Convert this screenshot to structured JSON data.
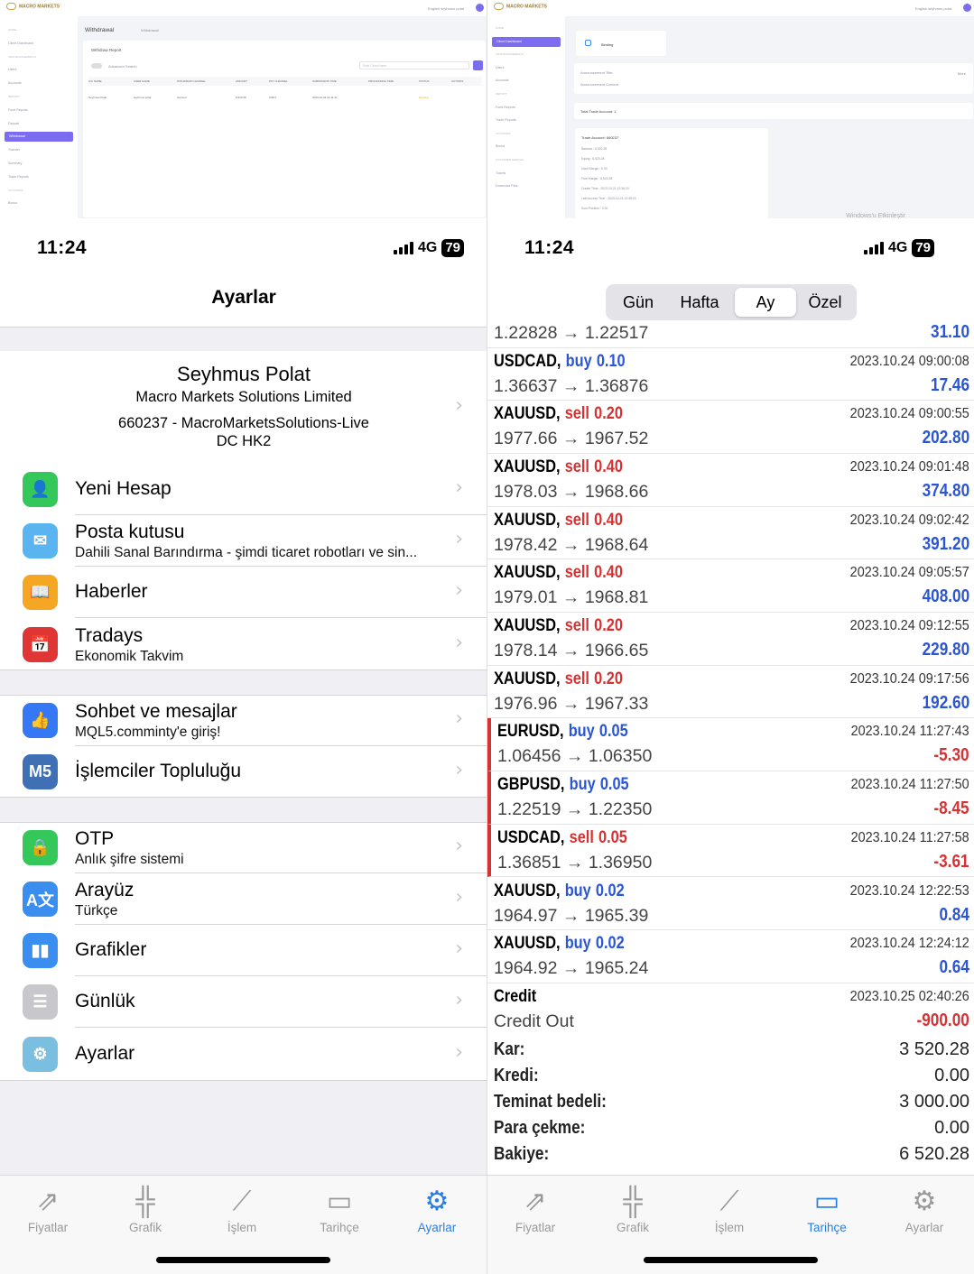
{
  "left": {
    "web": {
      "brand": "MACRO MARKETS",
      "page_title": "Withdrawal",
      "breadcrumb": "Withdrawal",
      "report_title": "Withdraw Report",
      "advanced_search": "Advanced Search",
      "search_placeholder": "Enter Client Name",
      "user_label": "English   seyhmus polat",
      "columns": [
        "A/C NAME",
        "USER NAME",
        "WITHDRAW CHANNEL",
        "AMOUNT",
        "PAY CHANNEL",
        "SUBMISSION TIME",
        "PROCESSING TIME",
        "STATUS",
        "ACTIONS"
      ],
      "row": [
        "Seyhmus Polat",
        "seyhmus polat",
        "Account",
        "6,520.28",
        "USDT",
        "2023-10-24 21:11:41",
        "",
        "Pending",
        ""
      ],
      "menu": [
        {
          "label": "HOME",
          "sec": true
        },
        {
          "label": "Client Dashboard"
        },
        {
          "label": "CRM MANAGEMENTS",
          "sec": true
        },
        {
          "label": "Users"
        },
        {
          "label": "Accounts"
        },
        {
          "label": "REPORT",
          "sec": true
        },
        {
          "label": "Fund Reports"
        },
        {
          "label": "Deposit"
        },
        {
          "label": "Withdrawal",
          "active": true
        },
        {
          "label": "Transfer"
        },
        {
          "label": "Summary"
        },
        {
          "label": "Trade Reports"
        },
        {
          "label": "ACTIVITIES",
          "sec": true
        },
        {
          "label": "Bonus"
        }
      ]
    },
    "status": {
      "time": "11:24",
      "network": "4G",
      "battery": "79"
    },
    "title": "Ayarlar",
    "account": {
      "name": "Seyhmus Polat",
      "company": "Macro Markets Solutions Limited",
      "number": "660237 - MacroMarketsSolutions-Live",
      "server": "DC HK2"
    },
    "rows": [
      {
        "title": "Yeni Hesap",
        "sub": "",
        "icon": "new-account-icon",
        "color": "#34c759",
        "glyph": "👤"
      },
      {
        "title": "Posta kutusu",
        "sub": "Dahili Sanal Barındırma - şimdi ticaret robotları ve sin...",
        "icon": "mail-icon",
        "color": "#5ab4f0",
        "glyph": "✉"
      },
      {
        "title": "Haberler",
        "sub": "",
        "icon": "news-icon",
        "color": "#f5a623",
        "glyph": "📖"
      },
      {
        "title": "Tradays",
        "sub": "Ekonomik Takvim",
        "icon": "tradays-icon",
        "color": "#e03535",
        "glyph": "📅"
      },
      {
        "title": "Sohbet ve mesajlar",
        "sub": "MQL5.comminty'e giriş!",
        "icon": "chat-icon",
        "color": "#3478f6",
        "glyph": "👍"
      },
      {
        "title": "İşlemciler Topluluğu",
        "sub": "",
        "icon": "mql5-icon",
        "color": "#3f6fb5",
        "glyph": "M5"
      },
      {
        "title": "OTP",
        "sub": "Anlık şifre sistemi",
        "icon": "otp-icon",
        "color": "#34c759",
        "glyph": "🔒"
      },
      {
        "title": "Arayüz",
        "sub": "Türkçe",
        "icon": "language-icon",
        "color": "#3a8ef0",
        "glyph": "A文"
      },
      {
        "title": "Grafikler",
        "sub": "",
        "icon": "charts-icon",
        "color": "#3a8ef0",
        "glyph": "▮▮"
      },
      {
        "title": "Günlük",
        "sub": "",
        "icon": "journal-icon",
        "color": "#c8c8cc",
        "glyph": "☰"
      },
      {
        "title": "Ayarlar",
        "sub": "",
        "icon": "settings-app-icon",
        "color": "#7bbfe0",
        "glyph": "⚙"
      }
    ],
    "tabs": [
      {
        "label": "Fiyatlar",
        "icon": "quotes-icon",
        "glyph": "⇗"
      },
      {
        "label": "Grafik",
        "icon": "chart-tab-icon",
        "glyph": "╬"
      },
      {
        "label": "İşlem",
        "icon": "trade-icon",
        "glyph": "⟋"
      },
      {
        "label": "Tarihçe",
        "icon": "history-icon",
        "glyph": "▭"
      },
      {
        "label": "Ayarlar",
        "icon": "settings-icon",
        "glyph": "⚙",
        "active": true
      }
    ]
  },
  "right": {
    "web": {
      "brand": "MACRO MARKETS",
      "binding": "Binding",
      "announcement_title": "Announcement Title:",
      "announcement_content": "Announcement Content",
      "more": "More",
      "total": "Total Trade Account: 1",
      "trade_account": "Trade Account: 660237",
      "watermark": "Windows'u Etkinleştir",
      "user_label": "English   seyhmus polat",
      "details": [
        "Balance : 6,520.28",
        "Equity : 6,520.28",
        "Used Margin : 0.00",
        "Free Margin : 6,520.28",
        "Create Time : 2023-10-21 12:36:20",
        "Last Access Time : 2023-10-21 22:08:23",
        "Sum Position : 0.00"
      ],
      "menu": [
        {
          "label": "HOME",
          "sec": true
        },
        {
          "label": "Client Dashboard",
          "active": true
        },
        {
          "label": "CRM MANAGEMENTS",
          "sec": true
        },
        {
          "label": "Users"
        },
        {
          "label": "Accounts"
        },
        {
          "label": "REPORT",
          "sec": true
        },
        {
          "label": "Fund Reports"
        },
        {
          "label": "Trade Reports"
        },
        {
          "label": "ACTIVITIES",
          "sec": true
        },
        {
          "label": "Bonus"
        },
        {
          "label": "CUSTOMER SERVICE",
          "sec": true
        },
        {
          "label": "Tickets"
        },
        {
          "label": "Download Files"
        }
      ]
    },
    "status": {
      "time": "11:24",
      "network": "4G",
      "battery": "79"
    },
    "segments": [
      "Gün",
      "Hafta",
      "Ay",
      "Özel"
    ],
    "selected_segment": "Ay",
    "top_partial": {
      "price": "1.22828 → 1.22517",
      "profit": "31.10"
    },
    "deals": [
      {
        "symbol": "USDCAD,",
        "side": "buy",
        "lot": "0.10",
        "price": "1.36637 → 1.36876",
        "time": "2023.10.24 09:00:08",
        "profit": "17.46",
        "neg": false
      },
      {
        "symbol": "XAUUSD,",
        "side": "sell",
        "lot": "0.20",
        "price": "1977.66 → 1967.52",
        "time": "2023.10.24 09:00:55",
        "profit": "202.80",
        "neg": false
      },
      {
        "symbol": "XAUUSD,",
        "side": "sell",
        "lot": "0.40",
        "price": "1978.03 → 1968.66",
        "time": "2023.10.24 09:01:48",
        "profit": "374.80",
        "neg": false
      },
      {
        "symbol": "XAUUSD,",
        "side": "sell",
        "lot": "0.40",
        "price": "1978.42 → 1968.64",
        "time": "2023.10.24 09:02:42",
        "profit": "391.20",
        "neg": false
      },
      {
        "symbol": "XAUUSD,",
        "side": "sell",
        "lot": "0.40",
        "price": "1979.01 → 1968.81",
        "time": "2023.10.24 09:05:57",
        "profit": "408.00",
        "neg": false
      },
      {
        "symbol": "XAUUSD,",
        "side": "sell",
        "lot": "0.20",
        "price": "1978.14 → 1966.65",
        "time": "2023.10.24 09:12:55",
        "profit": "229.80",
        "neg": false
      },
      {
        "symbol": "XAUUSD,",
        "side": "sell",
        "lot": "0.20",
        "price": "1976.96 → 1967.33",
        "time": "2023.10.24 09:17:56",
        "profit": "192.60",
        "neg": false
      },
      {
        "symbol": "EURUSD,",
        "side": "buy",
        "lot": "0.05",
        "price": "1.06456 → 1.06350",
        "time": "2023.10.24 11:27:43",
        "profit": "-5.30",
        "neg": true
      },
      {
        "symbol": "GBPUSD,",
        "side": "buy",
        "lot": "0.05",
        "price": "1.22519 → 1.22350",
        "time": "2023.10.24 11:27:50",
        "profit": "-8.45",
        "neg": true
      },
      {
        "symbol": "USDCAD,",
        "side": "sell",
        "lot": "0.05",
        "price": "1.36851 → 1.36950",
        "time": "2023.10.24 11:27:58",
        "profit": "-3.61",
        "neg": true
      },
      {
        "symbol": "XAUUSD,",
        "side": "buy",
        "lot": "0.02",
        "price": "1964.97 → 1965.39",
        "time": "2023.10.24 12:22:53",
        "profit": "0.84",
        "neg": false
      },
      {
        "symbol": "XAUUSD,",
        "side": "buy",
        "lot": "0.02",
        "price": "1964.92 → 1965.24",
        "time": "2023.10.24 12:24:12",
        "profit": "0.64",
        "neg": false
      },
      {
        "symbol": "Credit",
        "side": "",
        "lot": "",
        "price": "Credit Out",
        "time": "2023.10.25 02:40:26",
        "profit": "-900.00",
        "neg": true,
        "credit": true
      }
    ],
    "summary": [
      {
        "label": "Kar:",
        "value": "3 520.28"
      },
      {
        "label": "Kredi:",
        "value": "0.00"
      },
      {
        "label": "Teminat bedeli:",
        "value": "3 000.00"
      },
      {
        "label": "Para çekme:",
        "value": "0.00"
      },
      {
        "label": "Bakiye:",
        "value": "6 520.28"
      }
    ],
    "tabs": [
      {
        "label": "Fiyatlar",
        "icon": "quotes-icon",
        "glyph": "⇗"
      },
      {
        "label": "Grafik",
        "icon": "chart-tab-icon",
        "glyph": "╬"
      },
      {
        "label": "İşlem",
        "icon": "trade-icon",
        "glyph": "⟋"
      },
      {
        "label": "Tarihçe",
        "icon": "history-icon",
        "glyph": "▭",
        "active": true
      },
      {
        "label": "Ayarlar",
        "icon": "settings-icon",
        "glyph": "⚙"
      }
    ]
  }
}
